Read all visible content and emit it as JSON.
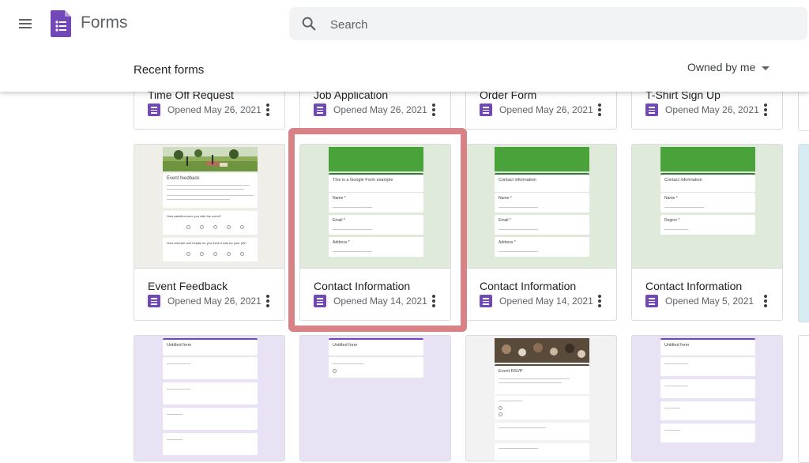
{
  "app": {
    "title": "Forms"
  },
  "search": {
    "placeholder": "Search",
    "value": ""
  },
  "section": {
    "title": "Recent forms",
    "owner_filter": "Owned by me"
  },
  "colors": {
    "forms_purple": "#7248b9",
    "highlight": "#d98285",
    "green_header": "#49a33a"
  },
  "rows": [
    {
      "cards": [
        {
          "title": "Time Off Request",
          "meta": "Opened May 26, 2021"
        },
        {
          "title": "Job Application",
          "meta": "Opened May 26, 2021"
        },
        {
          "title": "Order Form",
          "meta": "Opened May 26, 2021"
        },
        {
          "title": "T-Shirt Sign Up",
          "meta": "Opened May 26, 2021"
        }
      ]
    },
    {
      "cards": [
        {
          "title": "Event Feedback",
          "meta": "Opened May 26, 2021",
          "thumb": {
            "heading": "Event feedback",
            "q1": "How satisfied were you with the event?",
            "q2": "How relevant and helpful do you think it was for your job?"
          }
        },
        {
          "title": "Contact Information",
          "meta": "Opened May 14, 2021",
          "highlighted": true,
          "thumb": {
            "heading": "This is a Google Form example",
            "f1": "Name *",
            "f2": "Email *",
            "f3": "Address *"
          }
        },
        {
          "title": "Contact Information",
          "meta": "Opened May 14, 2021",
          "thumb": {
            "heading": "Contact information",
            "f1": "Name *",
            "f2": "Email *",
            "f3": "Address *"
          }
        },
        {
          "title": "Contact Information",
          "meta": "Opened May 5, 2021",
          "thumb": {
            "heading": "Contact information",
            "f1": "Name *",
            "f2": "Region *"
          }
        }
      ]
    },
    {
      "cards": [
        {
          "thumb": {
            "heading": "Untitled form"
          }
        },
        {
          "thumb": {
            "heading": "Untitled form"
          }
        },
        {
          "thumb": {
            "heading": "Event RSVP"
          }
        },
        {
          "thumb": {
            "heading": "Untitled form"
          }
        }
      ]
    }
  ]
}
